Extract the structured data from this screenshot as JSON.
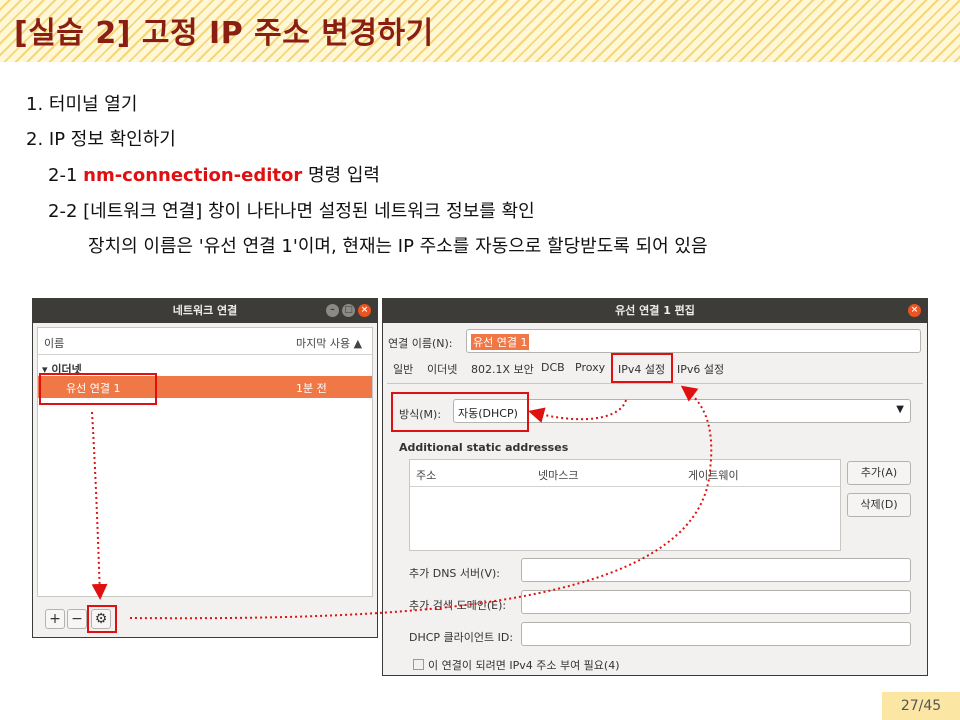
{
  "slide": {
    "title": "[실습 2] 고정 IP 주소 변경하기",
    "page": "27/45",
    "step1": "1. 터미널 열기",
    "step2": "2. IP 정보 확인하기",
    "step2_1_prefix": "2-1 ",
    "step2_1_command": "nm-connection-editor",
    "step2_1_suffix": " 명령 입력",
    "step2_2": "2-2 [네트워크 연결] 창이 나타나면 설정된 네트워크 정보를 확인",
    "step2_2_detail": "장치의 이름은 '유선 연결 1'이며, 현재는 IP 주소를 자동으로 할당받도록 되어 있음"
  },
  "network_window": {
    "title": "네트워크 연결",
    "col_name": "이름",
    "col_last_used": "마지막 사용 ▲",
    "group": "▾ 이더넷",
    "connection_name": "유선 연결 1",
    "connection_last_used": "1분 전",
    "add_label": "+",
    "remove_label": "−",
    "settings_label": "⚙"
  },
  "edit_window": {
    "title": "유선 연결 1 편집",
    "conn_name_label": "연결 이름(N):",
    "conn_name_value": "유선 연결 1",
    "tabs": [
      "일반",
      "이더넷",
      "802.1X 보안",
      "DCB",
      "Proxy",
      "IPv4 설정",
      "IPv6 설정"
    ],
    "method_label": "방식(M):",
    "method_value": "자동(DHCP)",
    "static_header": "Additional static addresses",
    "col_address": "주소",
    "col_netmask": "넷마스크",
    "col_gateway": "게이트웨이",
    "add_button": "추가(A)",
    "delete_button": "삭제(D)",
    "dns_label": "추가 DNS 서버(V):",
    "search_label": "추가 검색 도메인(E):",
    "dhcp_label": "DHCP 클라이언트 ID:",
    "require_label": "이 연결이 되려면 IPv4 주소 부여 필요(4)"
  },
  "colors": {
    "accent": "#f07746",
    "highlight": "#e01010",
    "titlebar": "#3d3c38"
  }
}
